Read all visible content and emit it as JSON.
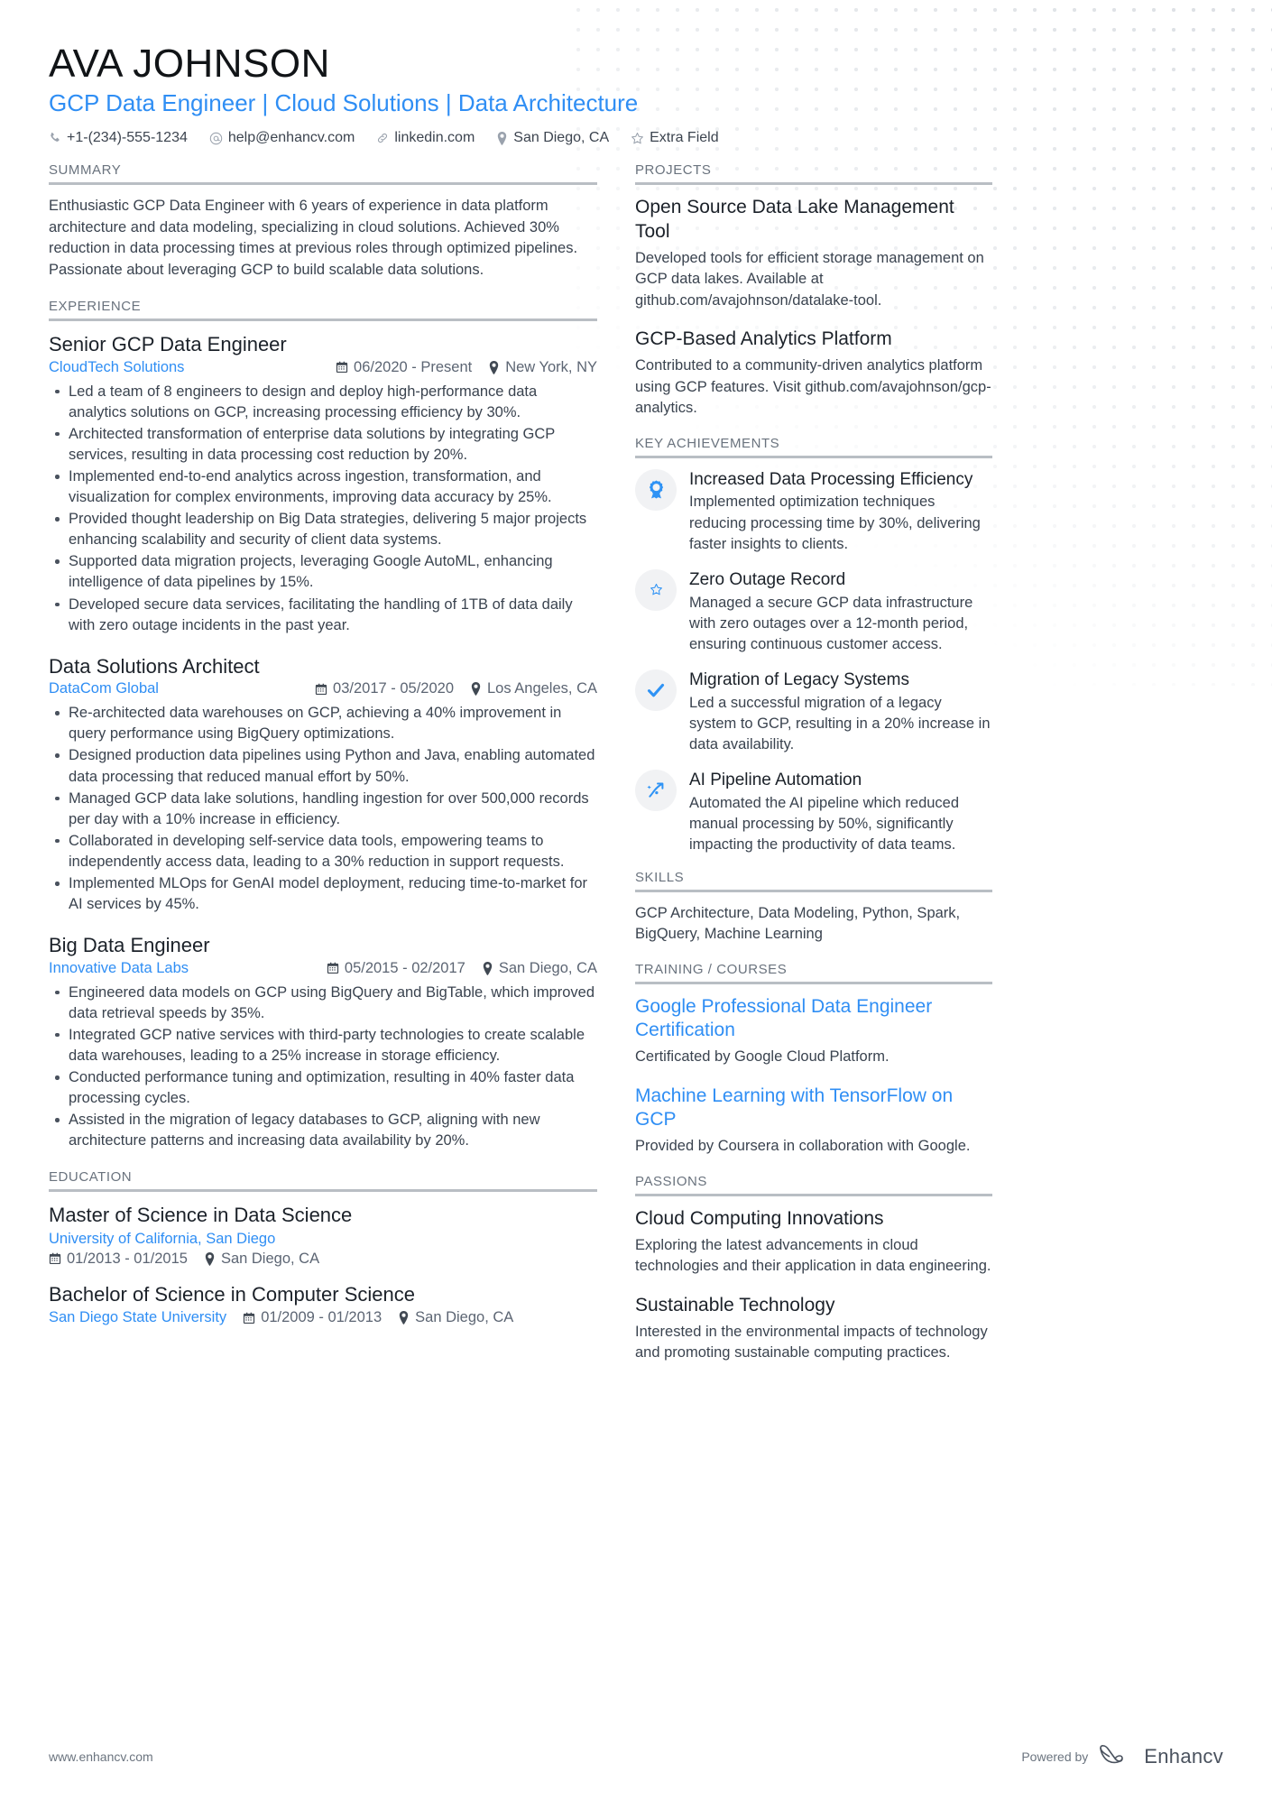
{
  "header": {
    "name": "AVA JOHNSON",
    "headline": "GCP Data Engineer | Cloud Solutions | Data Architecture",
    "contacts": [
      {
        "icon": "phone-icon",
        "text": "+1-(234)-555-1234"
      },
      {
        "icon": "email-icon",
        "text": "help@enhancv.com"
      },
      {
        "icon": "link-icon",
        "text": "linkedin.com"
      },
      {
        "icon": "location-icon",
        "text": "San Diego, CA"
      },
      {
        "icon": "star-icon",
        "text": "Extra Field"
      }
    ]
  },
  "accent_color": "#2f8ef4",
  "sections": {
    "summary": {
      "title": "SUMMARY",
      "text": "Enthusiastic GCP Data Engineer with 6 years of experience in data platform architecture and data modeling, specializing in cloud solutions. Achieved 30% reduction in data processing times at previous roles through optimized pipelines. Passionate about leveraging GCP to build scalable data solutions."
    },
    "experience": {
      "title": "EXPERIENCE",
      "jobs": [
        {
          "title": "Senior GCP Data Engineer",
          "company": "CloudTech Solutions",
          "dates": "06/2020 - Present",
          "location": "New York, NY",
          "bullets": [
            "Led a team of 8 engineers to design and deploy high-performance data analytics solutions on GCP, increasing processing efficiency by 30%.",
            "Architected transformation of enterprise data solutions by integrating GCP services, resulting in data processing cost reduction by 20%.",
            "Implemented end-to-end analytics across ingestion, transformation, and visualization for complex environments, improving data accuracy by 25%.",
            "Provided thought leadership on Big Data strategies, delivering 5 major projects enhancing scalability and security of client data systems.",
            "Supported data migration projects, leveraging Google AutoML, enhancing intelligence of data pipelines by 15%.",
            "Developed secure data services, facilitating the handling of 1TB of data daily with zero outage incidents in the past year."
          ]
        },
        {
          "title": "Data Solutions Architect",
          "company": "DataCom Global",
          "dates": "03/2017 - 05/2020",
          "location": "Los Angeles, CA",
          "bullets": [
            "Re-architected data warehouses on GCP, achieving a 40% improvement in query performance using BigQuery optimizations.",
            "Designed production data pipelines using Python and Java, enabling automated data processing that reduced manual effort by 50%.",
            "Managed GCP data lake solutions, handling ingestion for over 500,000 records per day with a 10% increase in efficiency.",
            "Collaborated in developing self-service data tools, empowering teams to independently access data, leading to a 30% reduction in support requests.",
            "Implemented MLOps for GenAI model deployment, reducing time-to-market for AI services by 45%."
          ]
        },
        {
          "title": "Big Data Engineer",
          "company": "Innovative Data Labs",
          "dates": "05/2015 - 02/2017",
          "location": "San Diego, CA",
          "bullets": [
            "Engineered data models on GCP using BigQuery and BigTable, which improved data retrieval speeds by 35%.",
            "Integrated GCP native services with third-party technologies to create scalable data warehouses, leading to a 25% increase in storage efficiency.",
            "Conducted performance tuning and optimization, resulting in 40% faster data processing cycles.",
            "Assisted in the migration of legacy databases to GCP, aligning with new architecture patterns and increasing data availability by 20%."
          ]
        }
      ]
    },
    "education": {
      "title": "EDUCATION",
      "items": [
        {
          "degree": "Master of Science in Data Science",
          "school": "University of California, San Diego",
          "dates": "01/2013 - 01/2015",
          "location": "San Diego, CA",
          "inline": false
        },
        {
          "degree": "Bachelor of Science in Computer Science",
          "school": "San Diego State University",
          "dates": "01/2009 - 01/2013",
          "location": "San Diego, CA",
          "inline": true
        }
      ]
    },
    "projects": {
      "title": "PROJECTS",
      "items": [
        {
          "name": "Open Source Data Lake Management Tool",
          "description": "Developed tools for efficient storage management on GCP data lakes. Available at github.com/avajohnson/datalake-tool."
        },
        {
          "name": "GCP-Based Analytics Platform",
          "description": "Contributed to a community-driven analytics platform using GCP features. Visit github.com/avajohnson/gcp-analytics."
        }
      ]
    },
    "key_achievements": {
      "title": "KEY ACHIEVEMENTS",
      "items": [
        {
          "icon": "award-ribbon-icon",
          "heading": "Increased Data Processing Efficiency",
          "text": "Implemented optimization techniques reducing processing time by 30%, delivering faster insights to clients."
        },
        {
          "icon": "star-icon",
          "heading": "Zero Outage Record",
          "text": "Managed a secure GCP data infrastructure with zero outages over a 12-month period, ensuring continuous customer access."
        },
        {
          "icon": "check-icon",
          "heading": "Migration of Legacy Systems",
          "text": "Led a successful migration of a legacy system to GCP, resulting in a 20% increase in data availability."
        },
        {
          "icon": "trending-arrow-icon",
          "heading": "AI Pipeline Automation",
          "text": "Automated the AI pipeline which reduced manual processing by 50%, significantly impacting the productivity of data teams."
        }
      ]
    },
    "skills": {
      "title": "SKILLS",
      "text": "GCP Architecture, Data Modeling, Python, Spark, BigQuery, Machine Learning"
    },
    "training": {
      "title": "TRAINING / COURSES",
      "items": [
        {
          "name": "Google Professional Data Engineer Certification",
          "description": "Certificated by Google Cloud Platform."
        },
        {
          "name": "Machine Learning with TensorFlow on GCP",
          "description": "Provided by Coursera in collaboration with Google."
        }
      ]
    },
    "passions": {
      "title": "PASSIONS",
      "items": [
        {
          "name": "Cloud Computing Innovations",
          "description": "Exploring the latest advancements in cloud technologies and their application in data engineering."
        },
        {
          "name": "Sustainable Technology",
          "description": "Interested in the environmental impacts of technology and promoting sustainable computing practices."
        }
      ]
    }
  },
  "footer": {
    "website": "www.enhancv.com",
    "powered_by": "Powered by",
    "brand": "Enhancv"
  }
}
